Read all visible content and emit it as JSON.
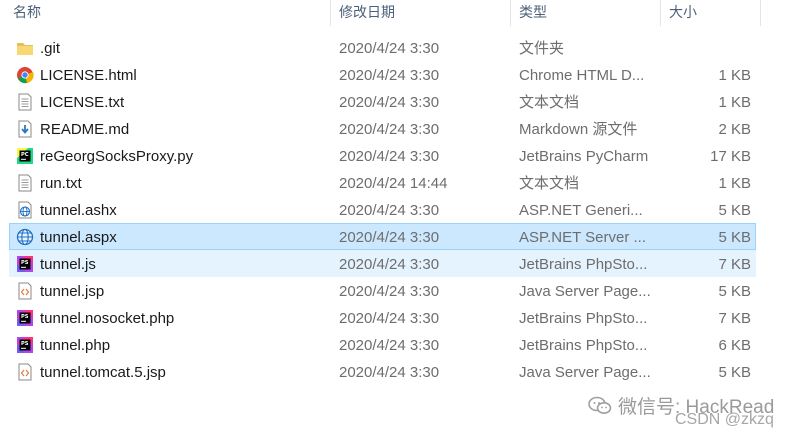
{
  "header": {
    "name": "名称",
    "date": "修改日期",
    "type": "类型",
    "size": "大小"
  },
  "files": [
    {
      "name": ".git",
      "date": "2020/4/24 3:30",
      "type": "文件夹",
      "size": "",
      "icon": "folder-icon"
    },
    {
      "name": "LICENSE.html",
      "date": "2020/4/24 3:30",
      "type": "Chrome HTML D...",
      "size": "1 KB",
      "icon": "chrome-icon"
    },
    {
      "name": "LICENSE.txt",
      "date": "2020/4/24 3:30",
      "type": "文本文档",
      "size": "1 KB",
      "icon": "text-file-icon"
    },
    {
      "name": "README.md",
      "date": "2020/4/24 3:30",
      "type": "Markdown 源文件",
      "size": "2 KB",
      "icon": "markdown-file-icon"
    },
    {
      "name": "reGeorgSocksProxy.py",
      "date": "2020/4/24 3:30",
      "type": "JetBrains PyCharm",
      "size": "17 KB",
      "icon": "pycharm-icon"
    },
    {
      "name": "run.txt",
      "date": "2020/4/24 14:44",
      "type": "文本文档",
      "size": "1 KB",
      "icon": "text-file-icon"
    },
    {
      "name": "tunnel.ashx",
      "date": "2020/4/24 3:30",
      "type": "ASP.NET Generi...",
      "size": "5 KB",
      "icon": "aspnet-file-icon"
    },
    {
      "name": "tunnel.aspx",
      "date": "2020/4/24 3:30",
      "type": "ASP.NET Server ...",
      "size": "5 KB",
      "icon": "globe-icon"
    },
    {
      "name": "tunnel.js",
      "date": "2020/4/24 3:30",
      "type": "JetBrains PhpSto...",
      "size": "7 KB",
      "icon": "phpstorm-icon"
    },
    {
      "name": "tunnel.jsp",
      "date": "2020/4/24 3:30",
      "type": "Java Server Page...",
      "size": "5 KB",
      "icon": "jsp-file-icon"
    },
    {
      "name": "tunnel.nosocket.php",
      "date": "2020/4/24 3:30",
      "type": "JetBrains PhpSto...",
      "size": "7 KB",
      "icon": "phpstorm-icon"
    },
    {
      "name": "tunnel.php",
      "date": "2020/4/24 3:30",
      "type": "JetBrains PhpSto...",
      "size": "6 KB",
      "icon": "phpstorm-icon"
    },
    {
      "name": "tunnel.tomcat.5.jsp",
      "date": "2020/4/24 3:30",
      "type": "Java Server Page...",
      "size": "5 KB",
      "icon": "jsp-file-icon"
    }
  ],
  "selected_index": 7,
  "hover_index": 8,
  "watermark": {
    "wechat": "微信号: HackRead",
    "csdn": "CSDN @zkzq"
  },
  "colors": {
    "selected_bg": "#cce8ff",
    "selected_border": "#99d1ff",
    "hover_bg": "#e5f3ff",
    "header_text": "#4c607a"
  }
}
